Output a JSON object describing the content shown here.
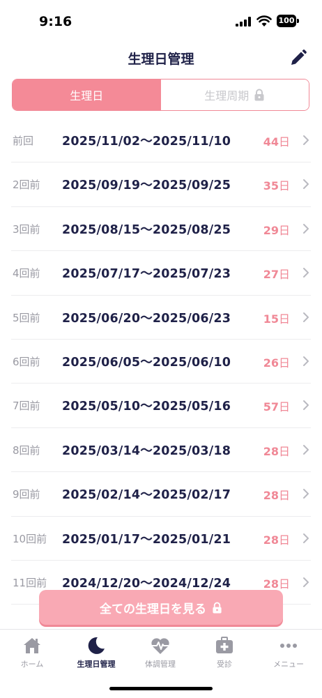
{
  "status": {
    "time": "9:16",
    "battery": "100"
  },
  "nav": {
    "title": "生理日管理"
  },
  "segments": {
    "period": "生理日",
    "cycle": "生理周期"
  },
  "records": [
    {
      "label": "前回",
      "dates": "2025/11/02〜2025/11/10",
      "days": "44",
      "unit": "日"
    },
    {
      "label": "2回前",
      "dates": "2025/09/19〜2025/09/25",
      "days": "35",
      "unit": "日"
    },
    {
      "label": "3回前",
      "dates": "2025/08/15〜2025/08/25",
      "days": "29",
      "unit": "日"
    },
    {
      "label": "4回前",
      "dates": "2025/07/17〜2025/07/23",
      "days": "27",
      "unit": "日"
    },
    {
      "label": "5回前",
      "dates": "2025/06/20〜2025/06/23",
      "days": "15",
      "unit": "日"
    },
    {
      "label": "6回前",
      "dates": "2025/06/05〜2025/06/10",
      "days": "26",
      "unit": "日"
    },
    {
      "label": "7回前",
      "dates": "2025/05/10〜2025/05/16",
      "days": "57",
      "unit": "日"
    },
    {
      "label": "8回前",
      "dates": "2025/03/14〜2025/03/18",
      "days": "28",
      "unit": "日"
    },
    {
      "label": "9回前",
      "dates": "2025/02/14〜2025/02/17",
      "days": "28",
      "unit": "日"
    },
    {
      "label": "10回前",
      "dates": "2025/01/17〜2025/01/21",
      "days": "28",
      "unit": "日"
    },
    {
      "label": "11回前",
      "dates": "2024/12/20〜2024/12/24",
      "days": "28",
      "unit": "日"
    }
  ],
  "view_all": "全ての生理日を見る",
  "tabs": [
    {
      "label": "ホーム",
      "icon": "home-icon"
    },
    {
      "label": "生理日管理",
      "icon": "moon-icon"
    },
    {
      "label": "体調管理",
      "icon": "heart-pulse-icon"
    },
    {
      "label": "受診",
      "icon": "medical-kit-icon"
    },
    {
      "label": "メニュー",
      "icon": "more-icon"
    }
  ],
  "colors": {
    "accent": "#f48a97",
    "navy": "#1f2148",
    "gray": "#9a9aa3"
  }
}
